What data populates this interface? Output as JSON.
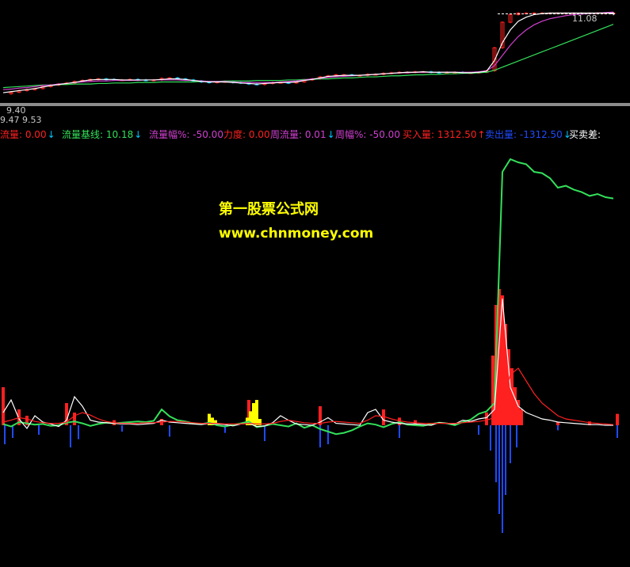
{
  "colors": {
    "background": "#000000",
    "up": "#ff2020",
    "down": "#1f4bff",
    "green": "#33e05a",
    "white": "#ffffff",
    "magenta": "#d040d0",
    "yellow": "#ffff00",
    "cyan": "#00c8ff",
    "separator": "#8c8c8c"
  },
  "price_panel": {
    "last_price_label": "11.08",
    "low_label": "9.40",
    "range_label": "9.47  9.53"
  },
  "indicator_bar": [
    {
      "name": "流量",
      "value": "0.00",
      "arrow": "↓",
      "color": "#ff2020"
    },
    {
      "name": "流量基线",
      "value": "10.18",
      "arrow": "↓",
      "color": "#33e05a"
    },
    {
      "name": "流量幅%",
      "value": "-50.00",
      "arrow": "",
      "color": "#d040d0"
    },
    {
      "name": "力度",
      "value": "0.00",
      "arrow": "",
      "color": "#ff2020"
    },
    {
      "name": "周流量",
      "value": "0.01",
      "arrow": "↓",
      "color": "#d040d0"
    },
    {
      "name": "周幅%",
      "value": "-50.00",
      "arrow": "",
      "color": "#d040d0"
    },
    {
      "name": "买入量",
      "value": "1312.50",
      "arrow": "↑",
      "color": "#ff2020"
    },
    {
      "name": "卖出量",
      "value": "-1312.50",
      "arrow": "↓",
      "color": "#1f4bff"
    },
    {
      "name": "买卖差",
      "value": "",
      "arrow": "",
      "color": "#ffffff"
    }
  ],
  "watermark": {
    "line1": "第一股票公式网",
    "line2": "www.chnmoney.com"
  },
  "chart_data": [
    {
      "type": "line",
      "panel": "price",
      "title": "",
      "x": [
        0,
        10,
        20,
        30,
        40,
        50,
        60,
        70,
        80,
        90,
        100,
        110,
        120,
        130,
        140,
        150,
        160,
        170,
        180,
        190,
        200,
        210,
        220,
        230,
        240,
        250,
        260,
        270,
        280,
        290,
        300,
        310,
        320,
        330,
        340,
        350,
        360,
        370,
        380,
        390,
        400,
        410,
        420,
        430,
        440,
        450,
        460,
        470,
        480,
        490,
        500,
        510,
        520,
        530,
        540,
        550,
        560,
        570,
        580,
        590,
        600,
        610,
        620,
        630,
        640,
        650,
        660,
        670,
        680,
        690,
        700,
        710,
        720,
        730,
        740,
        750,
        760,
        770
      ],
      "series": [
        {
          "role": "close",
          "color": "#ffffff",
          "values": [
            9.5,
            9.53,
            9.56,
            9.58,
            9.6,
            9.64,
            9.67,
            9.69,
            9.71,
            9.74,
            9.76,
            9.78,
            9.79,
            9.78,
            9.77,
            9.77,
            9.78,
            9.77,
            9.76,
            9.77,
            9.8,
            9.81,
            9.79,
            9.77,
            9.75,
            9.73,
            9.72,
            9.73,
            9.74,
            9.72,
            9.71,
            9.69,
            9.68,
            9.7,
            9.72,
            9.72,
            9.71,
            9.73,
            9.77,
            9.79,
            9.83,
            9.85,
            9.87,
            9.87,
            9.86,
            9.86,
            9.88,
            9.88,
            9.9,
            9.91,
            9.92,
            9.92,
            9.93,
            9.93,
            9.92,
            9.91,
            9.92,
            9.92,
            9.91,
            9.91,
            9.92,
            9.95,
            10.4,
            10.9,
            11.05,
            11.08,
            11.08,
            11.08,
            11.08,
            11.08,
            11.08,
            11.08,
            11.08,
            11.08,
            11.08,
            11.08,
            11.08,
            11.08
          ]
        },
        {
          "role": "ma_slow",
          "color": "#33e05a",
          "values": [
            9.62,
            9.63,
            9.64,
            9.65,
            9.66,
            9.67,
            9.67,
            9.68,
            9.68,
            9.69,
            9.69,
            9.69,
            9.7,
            9.7,
            9.71,
            9.71,
            9.71,
            9.72,
            9.72,
            9.72,
            9.73,
            9.73,
            9.73,
            9.73,
            9.73,
            9.74,
            9.74,
            9.74,
            9.75,
            9.75,
            9.75,
            9.75,
            9.76,
            9.76,
            9.76,
            9.76,
            9.77,
            9.77,
            9.78,
            9.78,
            9.79,
            9.79,
            9.8,
            9.81,
            9.81,
            9.82,
            9.83,
            9.83,
            9.84,
            9.85,
            9.85,
            9.86,
            9.87,
            9.87,
            9.88,
            9.88,
            9.89,
            9.89,
            9.9,
            9.9,
            9.91,
            9.92,
            9.96,
            10.02,
            10.08,
            10.14,
            10.2,
            10.26,
            10.32,
            10.38,
            10.44,
            10.5,
            10.56,
            10.62,
            10.68,
            10.74,
            10.8,
            10.86
          ]
        },
        {
          "role": "ma_mid",
          "color": "#d040d0",
          "values": [
            9.58,
            9.59,
            9.61,
            9.62,
            9.64,
            9.66,
            9.67,
            9.69,
            9.7,
            9.72,
            9.73,
            9.74,
            9.75,
            9.75,
            9.76,
            9.76,
            9.76,
            9.76,
            9.77,
            9.77,
            9.77,
            9.77,
            9.77,
            9.76,
            9.76,
            9.75,
            9.74,
            9.74,
            9.74,
            9.73,
            9.72,
            9.72,
            9.72,
            9.72,
            9.72,
            9.73,
            9.74,
            9.75,
            9.77,
            9.79,
            9.8,
            9.82,
            9.83,
            9.84,
            9.85,
            9.86,
            9.87,
            9.88,
            9.89,
            9.9,
            9.91,
            9.91,
            9.92,
            9.92,
            9.92,
            9.92,
            9.92,
            9.92,
            9.92,
            9.92,
            9.93,
            9.95,
            10.05,
            10.25,
            10.45,
            10.62,
            10.75,
            10.85,
            10.92,
            10.97,
            11.0,
            11.03,
            11.05,
            11.06,
            11.07,
            11.08,
            11.09,
            11.1
          ]
        },
        {
          "role": "ma_fast",
          "color": "#ffffff",
          "values": [
            9.52,
            9.54,
            9.56,
            9.58,
            9.6,
            9.63,
            9.66,
            9.68,
            9.7,
            9.72,
            9.75,
            9.77,
            9.78,
            9.78,
            9.78,
            9.77,
            9.77,
            9.77,
            9.77,
            9.77,
            9.78,
            9.79,
            9.79,
            9.78,
            9.76,
            9.74,
            9.73,
            9.73,
            9.73,
            9.72,
            9.71,
            9.7,
            9.69,
            9.7,
            9.71,
            9.72,
            9.72,
            9.73,
            9.76,
            9.78,
            9.81,
            9.84,
            9.85,
            9.86,
            9.86,
            9.86,
            9.87,
            9.88,
            9.89,
            9.9,
            9.91,
            9.92,
            9.92,
            9.93,
            9.92,
            9.92,
            9.92,
            9.92,
            9.91,
            9.91,
            9.92,
            9.94,
            10.15,
            10.5,
            10.75,
            10.92,
            11.0,
            11.05,
            11.07,
            11.08,
            11.08,
            11.08,
            11.08,
            11.08,
            11.08,
            11.08,
            11.08,
            11.08
          ]
        }
      ]
    },
    {
      "type": "line",
      "panel": "indicator",
      "title": "",
      "x": [
        0,
        10,
        20,
        30,
        40,
        50,
        60,
        70,
        80,
        90,
        100,
        110,
        120,
        130,
        140,
        150,
        160,
        170,
        180,
        190,
        200,
        210,
        220,
        230,
        240,
        250,
        260,
        270,
        280,
        290,
        300,
        310,
        320,
        330,
        340,
        350,
        360,
        370,
        380,
        390,
        400,
        410,
        420,
        430,
        440,
        450,
        460,
        470,
        480,
        490,
        500,
        510,
        520,
        530,
        540,
        550,
        560,
        570,
        580,
        590,
        600,
        610,
        620,
        630,
        640,
        650,
        660,
        670,
        680,
        690,
        700,
        710,
        720,
        730,
        740,
        750,
        760,
        770
      ],
      "series": [
        {
          "name": "流量基线",
          "color": "#33e05a",
          "values": [
            2,
            -2,
            5,
            3,
            1,
            2,
            -1,
            0,
            4,
            6,
            3,
            -1,
            2,
            4,
            3,
            4,
            5,
            6,
            5,
            7,
            25,
            14,
            8,
            6,
            3,
            2,
            4,
            0,
            -2,
            1,
            3,
            6,
            -3,
            -1,
            2,
            0,
            -2,
            3,
            -4,
            0,
            -6,
            -10,
            -14,
            -12,
            -8,
            -2,
            3,
            1,
            -3,
            2,
            5,
            1,
            0,
            -1,
            2,
            4,
            3,
            0,
            5,
            9,
            18,
            22,
            35,
            400,
            420,
            415,
            412,
            400,
            398,
            390,
            375,
            378,
            372,
            368,
            362,
            365,
            360,
            358
          ]
        },
        {
          "name": "流量",
          "color": "#ffffff",
          "values": [
            20,
            40,
            10,
            -5,
            15,
            5,
            2,
            -2,
            8,
            45,
            30,
            8,
            5,
            4,
            3,
            2,
            2,
            1,
            2,
            3,
            8,
            5,
            4,
            3,
            2,
            1,
            3,
            2,
            1,
            -1,
            2,
            3,
            -2,
            -1,
            4,
            15,
            8,
            2,
            1,
            0,
            5,
            12,
            3,
            2,
            1,
            0,
            20,
            25,
            8,
            5,
            3,
            2,
            2,
            1,
            0,
            4,
            3,
            2,
            8,
            6,
            10,
            12,
            25,
            200,
            60,
            30,
            20,
            15,
            10,
            8,
            5,
            4,
            3,
            2,
            1,
            1,
            0,
            0
          ]
        },
        {
          "name": "周流量",
          "color": "#ff2020",
          "values": [
            5,
            8,
            12,
            10,
            6,
            4,
            3,
            3,
            5,
            15,
            20,
            16,
            10,
            6,
            4,
            3,
            3,
            3,
            4,
            4,
            5,
            6,
            6,
            5,
            4,
            3,
            3,
            3,
            2,
            2,
            2,
            3,
            2,
            2,
            3,
            6,
            8,
            6,
            4,
            3,
            3,
            5,
            6,
            5,
            4,
            3,
            8,
            15,
            14,
            10,
            7,
            5,
            4,
            3,
            3,
            3,
            3,
            3,
            4,
            5,
            6,
            8,
            12,
            35,
            80,
            90,
            70,
            50,
            35,
            25,
            15,
            10,
            8,
            6,
            4,
            3,
            2,
            1
          ]
        }
      ],
      "bars_up": [
        {
          "x": 0,
          "v": 60
        },
        {
          "x": 20,
          "v": 25
        },
        {
          "x": 30,
          "v": 15
        },
        {
          "x": 80,
          "v": 35
        },
        {
          "x": 90,
          "v": 20
        },
        {
          "x": 140,
          "v": 8
        },
        {
          "x": 200,
          "v": 10
        },
        {
          "x": 260,
          "v": 18
        },
        {
          "x": 310,
          "v": 40
        },
        {
          "x": 400,
          "v": 30
        },
        {
          "x": 480,
          "v": 25
        },
        {
          "x": 500,
          "v": 12
        },
        {
          "x": 520,
          "v": 8
        },
        {
          "x": 610,
          "v": 20
        },
        {
          "x": 618,
          "v": 110
        },
        {
          "x": 622,
          "v": 190
        },
        {
          "x": 626,
          "v": 215
        },
        {
          "x": 630,
          "v": 205
        },
        {
          "x": 634,
          "v": 160
        },
        {
          "x": 638,
          "v": 120
        },
        {
          "x": 642,
          "v": 90
        },
        {
          "x": 646,
          "v": 60
        },
        {
          "x": 650,
          "v": 40
        },
        {
          "x": 654,
          "v": 25
        },
        {
          "x": 700,
          "v": 5
        },
        {
          "x": 740,
          "v": 6
        },
        {
          "x": 775,
          "v": 18
        }
      ],
      "bars_down": [
        {
          "x": 2,
          "v": -30
        },
        {
          "x": 12,
          "v": -20
        },
        {
          "x": 45,
          "v": -15
        },
        {
          "x": 85,
          "v": -35
        },
        {
          "x": 95,
          "v": -22
        },
        {
          "x": 150,
          "v": -10
        },
        {
          "x": 210,
          "v": -18
        },
        {
          "x": 280,
          "v": -12
        },
        {
          "x": 330,
          "v": -25
        },
        {
          "x": 400,
          "v": -35
        },
        {
          "x": 410,
          "v": -30
        },
        {
          "x": 500,
          "v": -20
        },
        {
          "x": 600,
          "v": -15
        },
        {
          "x": 615,
          "v": -40
        },
        {
          "x": 622,
          "v": -90
        },
        {
          "x": 626,
          "v": -140
        },
        {
          "x": 630,
          "v": -170
        },
        {
          "x": 634,
          "v": -110
        },
        {
          "x": 640,
          "v": -60
        },
        {
          "x": 648,
          "v": -35
        },
        {
          "x": 700,
          "v": -8
        },
        {
          "x": 775,
          "v": -20
        }
      ],
      "bars_yellow": [
        {
          "x": 260,
          "v": 18
        },
        {
          "x": 264,
          "v": 12
        },
        {
          "x": 268,
          "v": 8
        },
        {
          "x": 308,
          "v": 12
        },
        {
          "x": 312,
          "v": 22
        },
        {
          "x": 316,
          "v": 35
        },
        {
          "x": 320,
          "v": 40
        },
        {
          "x": 324,
          "v": 10
        }
      ]
    }
  ]
}
